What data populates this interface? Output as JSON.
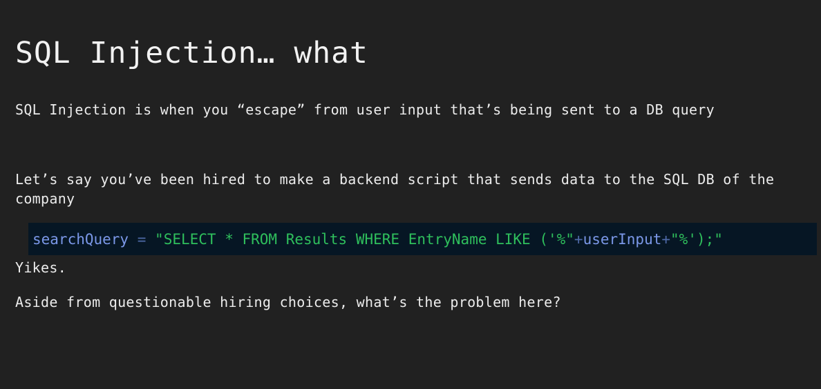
{
  "slide": {
    "title": "SQL Injection… what",
    "intro": "SQL Injection is when you “escape” from user input that’s being sent to a DB query",
    "setup": "Let’s say you’ve been hired to make a backend script that sends data to the SQL DB of the company",
    "code": {
      "var_name": "searchQuery",
      "assign_op": "=",
      "string_part1": "\"SELECT * FROM Results WHERE EntryName LIKE ('%\"",
      "concat_op1": "+",
      "input_var": "userInput",
      "concat_op2": "+",
      "string_part2": "\"%');\""
    },
    "reaction": "Yikes.",
    "question": "Aside from questionable hiring choices, what’s the problem here?"
  },
  "colors": {
    "background": "#212121",
    "code_background": "#061624",
    "code_variable": "#7b98e8",
    "code_operator": "#4f6aa8",
    "code_string": "#2fbf5c",
    "text": "#ececec"
  }
}
